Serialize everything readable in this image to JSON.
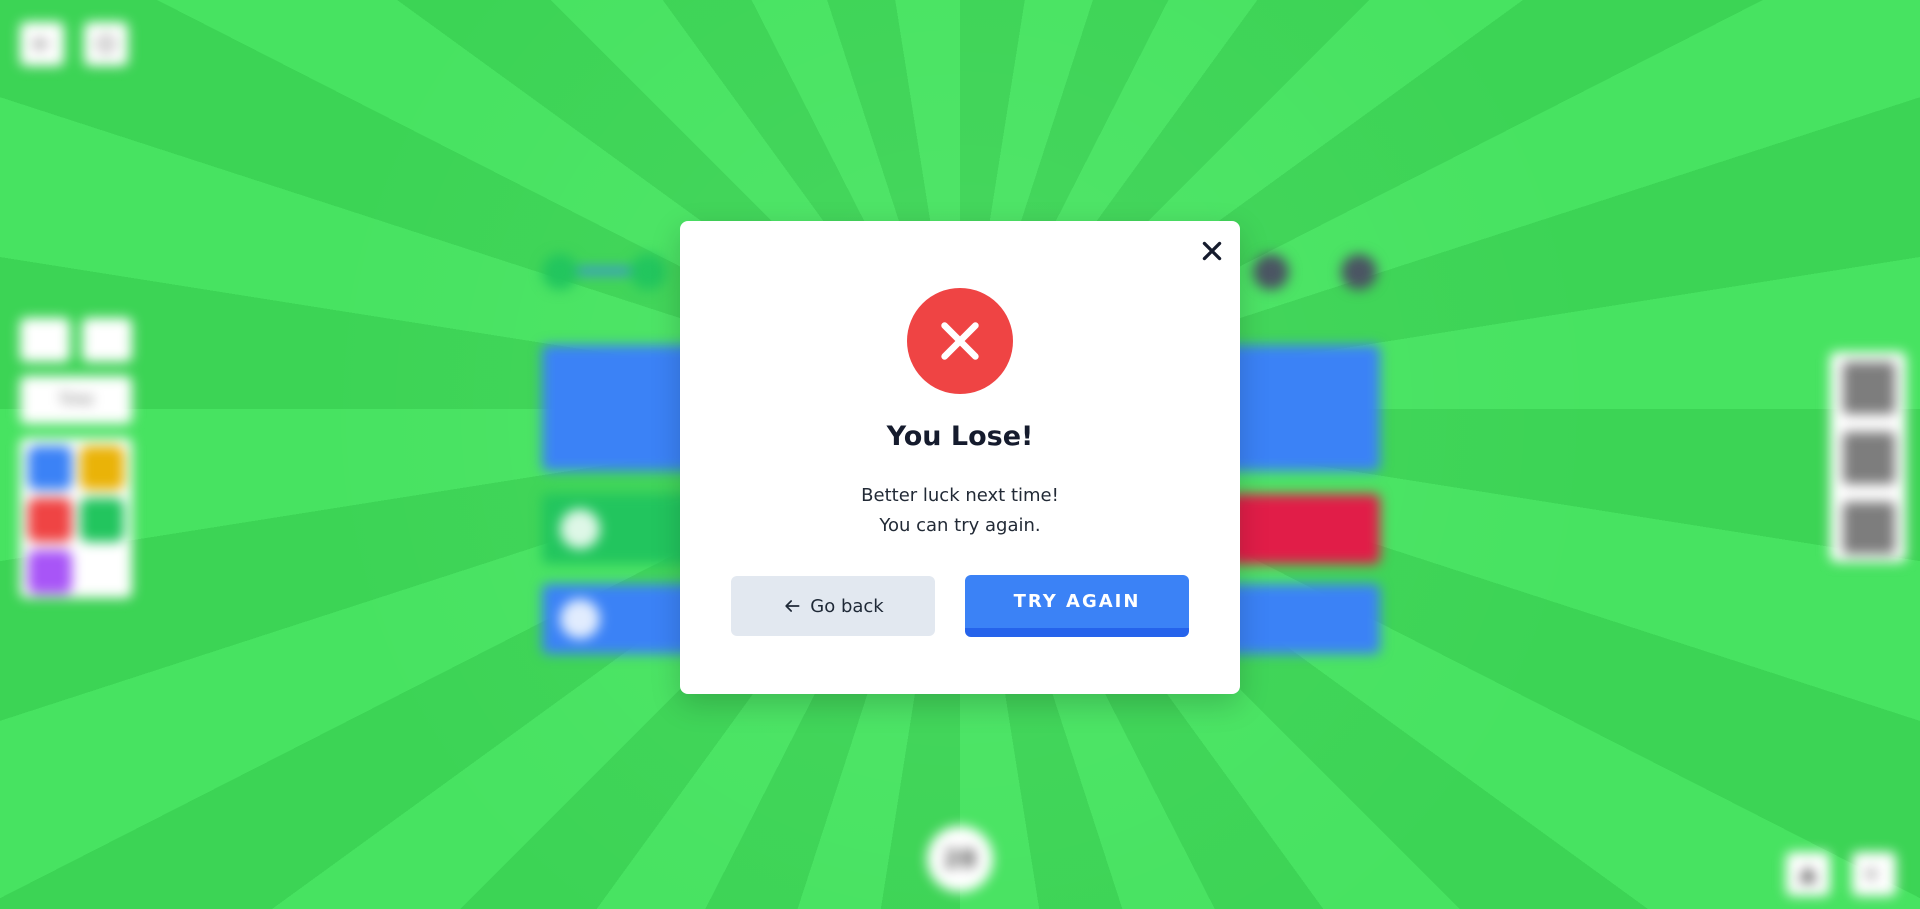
{
  "modal": {
    "title": "You Lose!",
    "message_line1": "Better luck next time!",
    "message_line2": "You can try again.",
    "go_back_label": "Go back",
    "try_again_label": "TRY AGAIN",
    "close_icon": "close-icon",
    "status_icon": "x-icon",
    "accent_red": "#ef4444",
    "accent_blue": "#3b82f6"
  },
  "background": {
    "timer_value": "28",
    "time_label": "Time",
    "theme_color": "#47e361"
  }
}
